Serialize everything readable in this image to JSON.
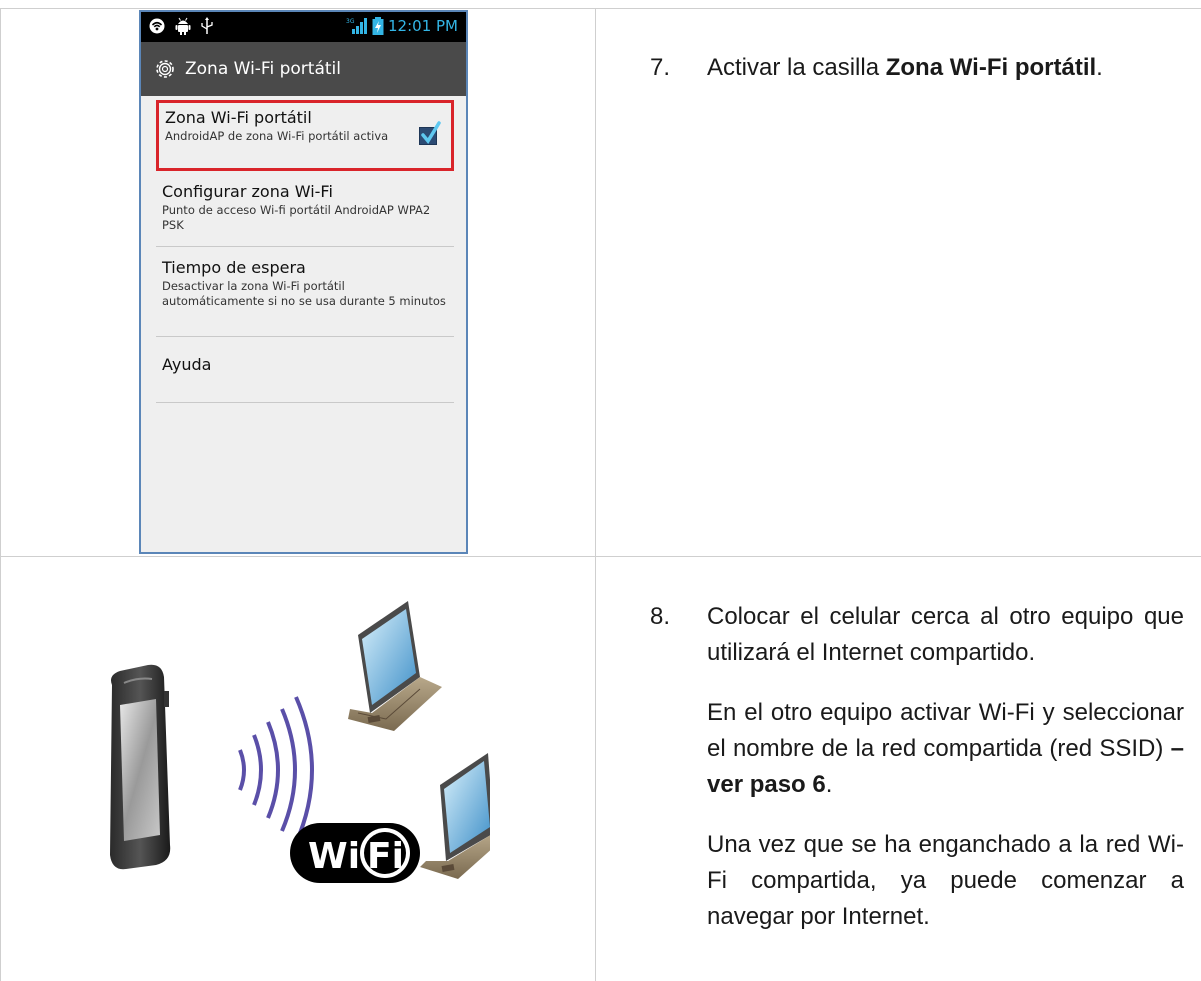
{
  "phone": {
    "status_time": "12:01 PM",
    "network_badge": "3G",
    "status_left_icons": [
      "wifi-hotspot-icon",
      "android-icon",
      "usb-icon"
    ],
    "actionbar_title": "Zona Wi-Fi portátil",
    "items": [
      {
        "title": "Zona Wi-Fi portátil",
        "subtitle": "AndroidAP de zona Wi-Fi portátil activa",
        "checked": true
      },
      {
        "title": "Configurar zona Wi-Fi",
        "subtitle": "Punto de acceso Wi-fi portátil AndroidAP WPA2 PSK"
      },
      {
        "title": "Tiempo de espera",
        "subtitle": "Desactivar la zona Wi-Fi portátil automáticamente si no se usa durante 5 minutos"
      },
      {
        "title": "Ayuda",
        "subtitle": ""
      }
    ]
  },
  "illustration": {
    "logo_text": "Wi Fi",
    "logo_part1": "Wi",
    "logo_part2": "Fi"
  },
  "step7": {
    "number": "7.",
    "text_before": "Activar la casilla ",
    "text_bold": "Zona Wi-Fi portátil",
    "text_after": "."
  },
  "step8": {
    "number": "8.",
    "p1": "Colocar el celular cerca al otro equipo que utilizará el Internet compartido.",
    "p2_before": "En el otro equipo activar Wi-Fi y seleccionar el nombre de la red compartida (red SSID) ",
    "p2_bold": " – ver paso 6",
    "p2_after": ".",
    "p3": "Una vez que se ha enganchado a la red Wi-Fi compartida, ya puede  comenzar a navegar por Internet."
  },
  "colors": {
    "highlight_border": "#d9242a",
    "phone_frame": "#5b86b8",
    "clock_blue": "#33b5e5",
    "checkbox": "#2c4b74",
    "wave_purple": "#5a4fa8"
  }
}
